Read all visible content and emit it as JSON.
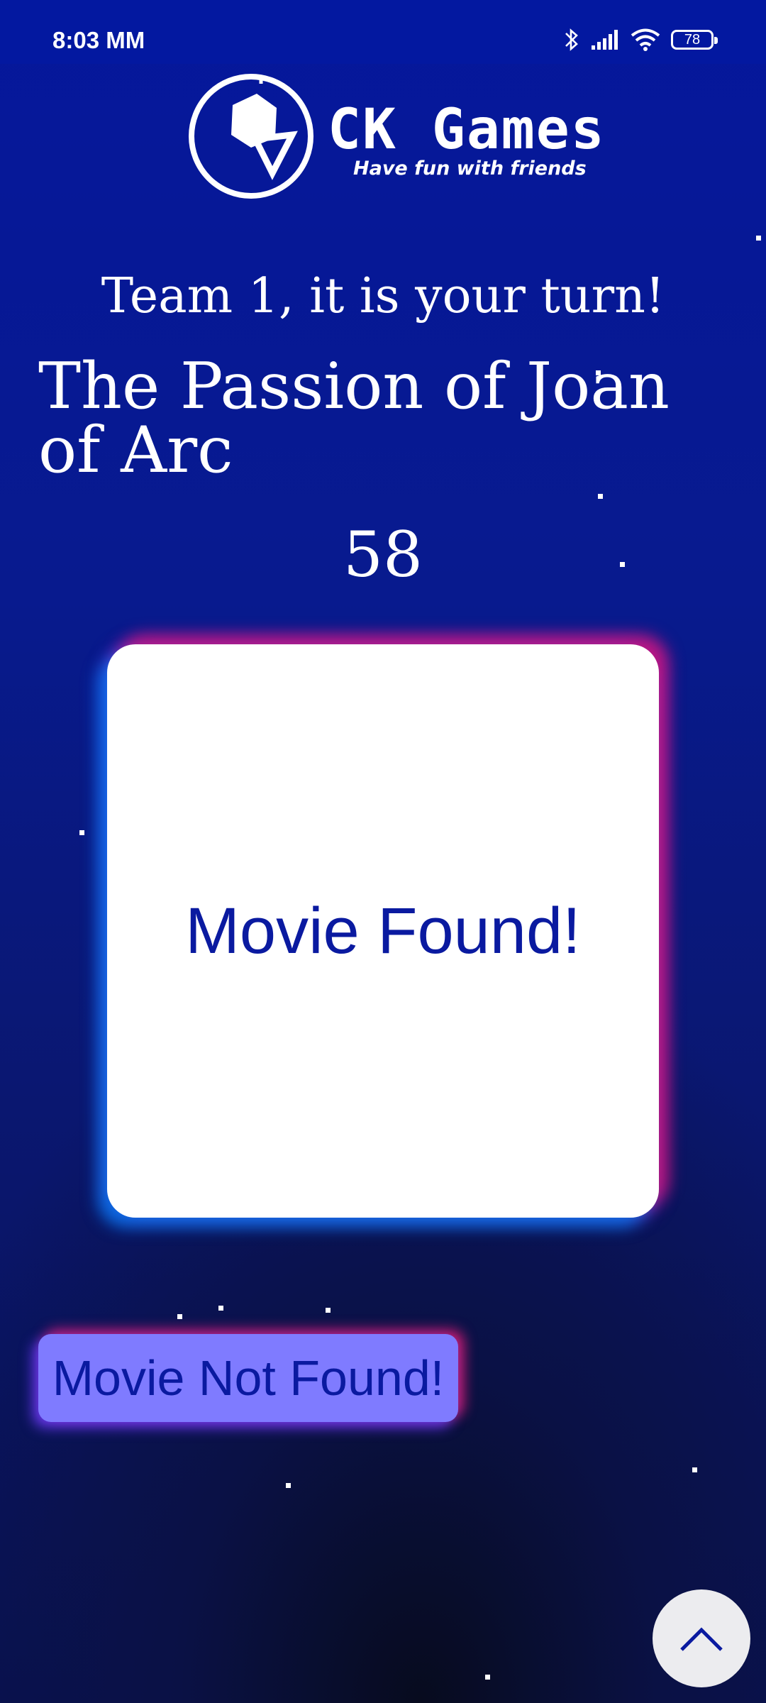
{
  "status_bar": {
    "time": "8:03 MM",
    "battery_level": "78",
    "icons": [
      "bluetooth-icon",
      "signal-icon",
      "wifi-icon",
      "battery-icon"
    ]
  },
  "logo": {
    "title": "CK Games",
    "tagline": "Have fun with friends"
  },
  "game": {
    "turn_text": "Team 1, it is your turn!",
    "movie_title": "The Passion of Joan of Arc",
    "timer": "58"
  },
  "actions": {
    "found_label": "Movie Found!",
    "not_found_label": "Movie Not Found!",
    "scroll_top_icon": "chevron-up-icon"
  },
  "colors": {
    "background": "#05179c",
    "accent_text": "#0a1aa0",
    "not_found_button": "#7f7bff",
    "card": "#ffffff"
  }
}
